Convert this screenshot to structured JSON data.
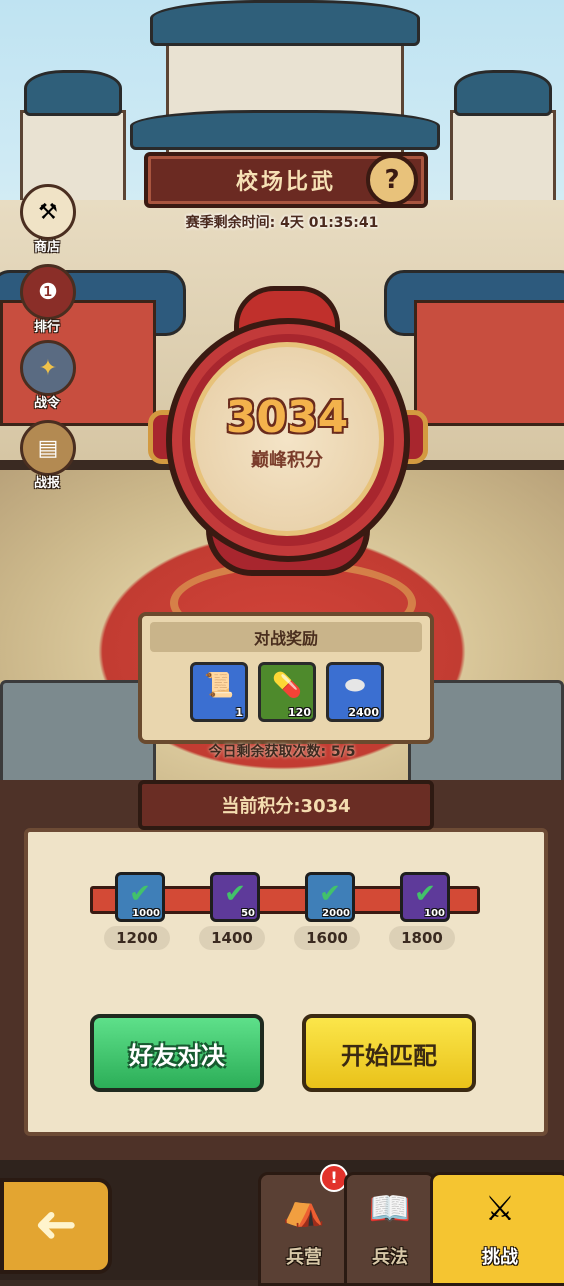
{
  "header": {
    "title": "校场比武",
    "help_glyph": "?",
    "season_time": "赛季剩余时间: 4天 01:35:41"
  },
  "side_menu": [
    {
      "label": "商店",
      "icon": "shop-icon"
    },
    {
      "label": "排行",
      "icon": "ranking-icon"
    },
    {
      "label": "战令",
      "icon": "battle-pass-icon"
    },
    {
      "label": "战报",
      "icon": "battle-report-icon"
    }
  ],
  "medallion": {
    "score": "3034",
    "label": "巅峰积分"
  },
  "rewards": {
    "title": "对战奖励",
    "items": [
      {
        "icon": "scroll-icon",
        "count": "1",
        "color": "#3b6fd1"
      },
      {
        "icon": "pill-icon",
        "count": "120",
        "color": "#4e8a2c"
      },
      {
        "icon": "silver-ingot-icon",
        "count": "2400",
        "color": "#3b6fd1"
      }
    ],
    "attempts": "今日剩余获取次数: 5/5"
  },
  "progress": {
    "current": "当前积分:3034",
    "milestones": [
      {
        "score": "1200",
        "count": "1000",
        "color": "#3f7fb8"
      },
      {
        "score": "1400",
        "count": "50",
        "color": "#5e3a9a"
      },
      {
        "score": "1600",
        "count": "2000",
        "color": "#3f7fb8"
      },
      {
        "score": "1800",
        "count": "100",
        "color": "#5e3a9a"
      }
    ]
  },
  "buttons": {
    "friend_battle": "好友对决",
    "start_match": "开始匹配"
  },
  "nav": {
    "back_glyph": "➜",
    "tabs": [
      {
        "label": "兵营",
        "icon": "barracks-icon",
        "active": false
      },
      {
        "label": "兵法",
        "icon": "strategy-icon",
        "active": false
      },
      {
        "label": "挑战",
        "icon": "challenge-icon",
        "active": true
      }
    ],
    "badge": "!"
  }
}
